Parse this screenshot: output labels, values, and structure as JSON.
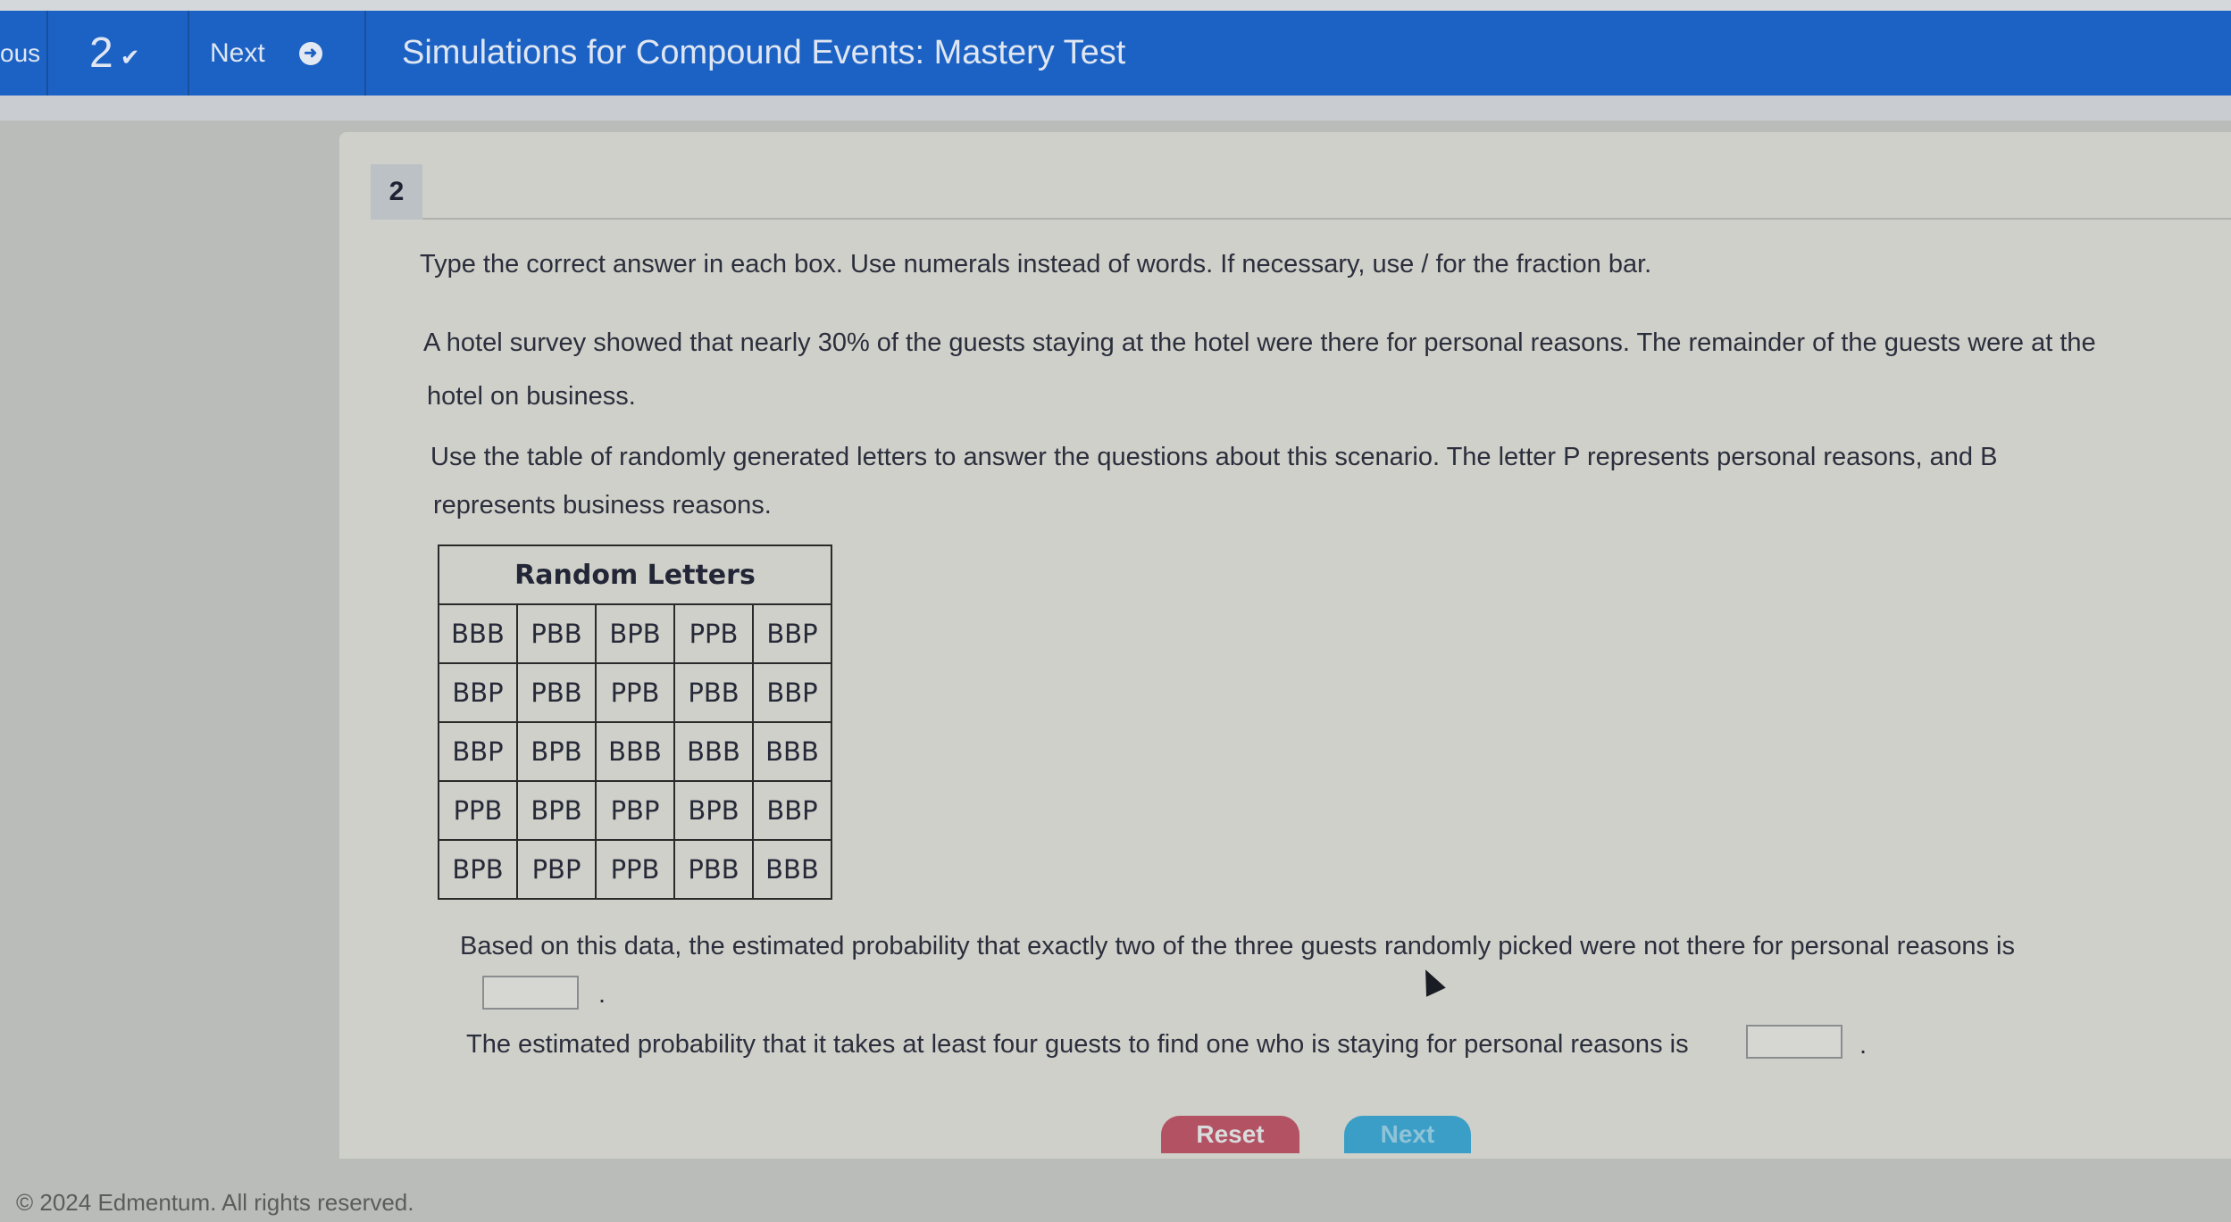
{
  "header": {
    "previous_label": "ous",
    "question_number": "2",
    "next_label": "Next",
    "title": "Simulations for Compound Events: Mastery Test",
    "accent_color": "#1c62c4"
  },
  "question": {
    "number": "2",
    "instructions": "Type the correct answer in each box. Use numerals instead of words. If necessary, use / for the fraction bar.",
    "paragraph1_line1": "A hotel survey showed that nearly 30% of the guests staying at the hotel were there for personal reasons. The remainder of the guests were at the",
    "paragraph1_line2": "hotel on business.",
    "paragraph2_line1": "Use the table of randomly generated letters to answer the questions about this scenario. The letter P represents personal reasons, and B",
    "paragraph2_line2": "represents business reasons.",
    "table": {
      "title": "Random Letters",
      "rows": [
        [
          "BBB",
          "PBB",
          "BPB",
          "PPB",
          "BBP"
        ],
        [
          "BBP",
          "PBB",
          "PPB",
          "PBB",
          "BBP"
        ],
        [
          "BBP",
          "BPB",
          "BBB",
          "BBB",
          "BBB"
        ],
        [
          "PPB",
          "BPB",
          "PBP",
          "BPB",
          "BBP"
        ],
        [
          "BPB",
          "PBP",
          "PPB",
          "PBB",
          "BBB"
        ]
      ]
    },
    "q1_text": "Based on this data, the estimated probability that exactly two of the three guests randomly picked were not there for personal reasons is",
    "q1_answer": "",
    "q1_suffix": ".",
    "q2_text": "The estimated probability that it takes at least four guests to find one who is staying for personal reasons is",
    "q2_answer": "",
    "q2_suffix": "."
  },
  "buttons": {
    "reset_label": "Reset",
    "next_label": "Next",
    "reset_color": "#b35263",
    "next_color": "#3b9ec7"
  },
  "footer": {
    "copyright": "© 2024 Edmentum. All rights reserved."
  }
}
